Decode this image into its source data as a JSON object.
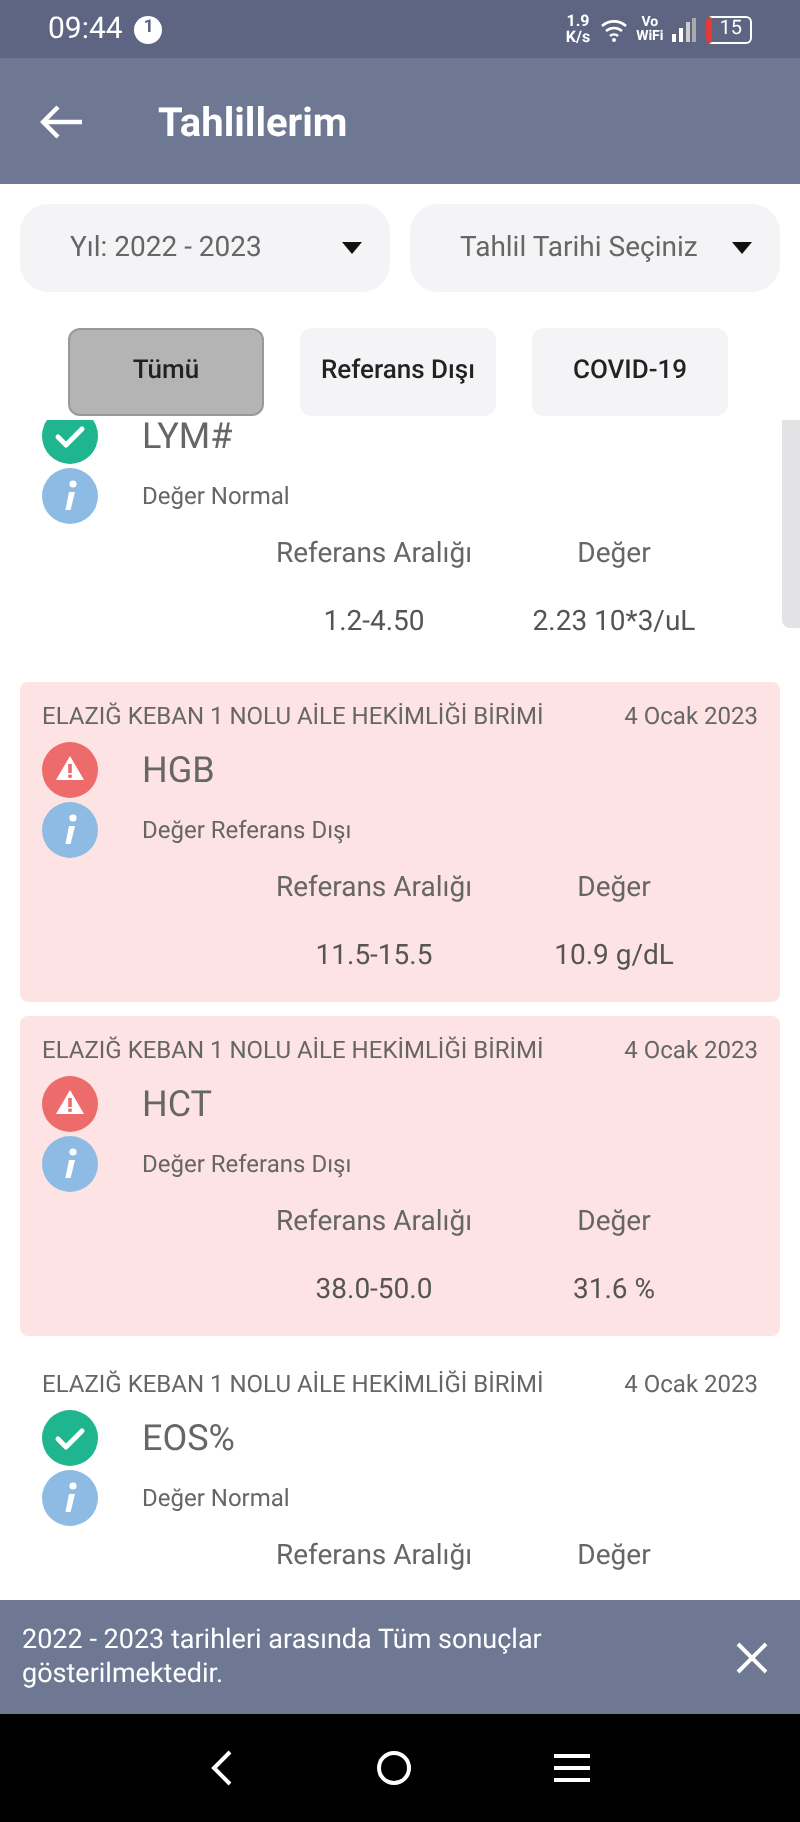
{
  "status_bar": {
    "time": "09:44",
    "notification_count": "1",
    "speed": "1.9",
    "speed_unit": "K/s",
    "volte": "Vo",
    "volte_sub": "WiFi",
    "battery": "15"
  },
  "app_bar": {
    "title": "Tahlillerim"
  },
  "filters": [
    {
      "label": "Yıl: 2022 - 2023"
    },
    {
      "label": "Tahlil Tarihi Seçiniz"
    }
  ],
  "tabs": [
    {
      "label": "Tümü",
      "selected": true
    },
    {
      "label": "Referans Dışı",
      "selected": false
    },
    {
      "label": "COVID-19",
      "selected": false
    }
  ],
  "results": [
    {
      "kind": "normal",
      "name": "LYM#",
      "status": "Değer Normal",
      "range_label": "Referans Aralığı",
      "value_label": "Değer",
      "range": "1.2-4.50",
      "value": "2.23 10*3/uL"
    },
    {
      "kind": "abnormal",
      "institution": "ELAZIĞ KEBAN 1 NOLU AİLE HEKİMLİĞİ BİRİMİ",
      "date": "4 Ocak 2023",
      "name": "HGB",
      "status": "Değer Referans Dışı",
      "range_label": "Referans Aralığı",
      "value_label": "Değer",
      "range": "11.5-15.5",
      "value": "10.9 g/dL"
    },
    {
      "kind": "abnormal",
      "institution": "ELAZIĞ KEBAN 1 NOLU AİLE HEKİMLİĞİ BİRİMİ",
      "date": "4 Ocak 2023",
      "name": "HCT",
      "status": "Değer Referans Dışı",
      "range_label": "Referans Aralığı",
      "value_label": "Değer",
      "range": "38.0-50.0",
      "value": "31.6 %"
    },
    {
      "kind": "normal",
      "institution": "ELAZIĞ KEBAN 1 NOLU AİLE HEKİMLİĞİ BİRİMİ",
      "date": "4 Ocak 2023",
      "name": "EOS%",
      "status": "Değer Normal",
      "range_label": "Referans Aralığı",
      "value_label": "Değer"
    }
  ],
  "banner": {
    "message": "2022 - 2023 tarihleri arasında Tüm sonuçlar gösterilmektedir."
  }
}
